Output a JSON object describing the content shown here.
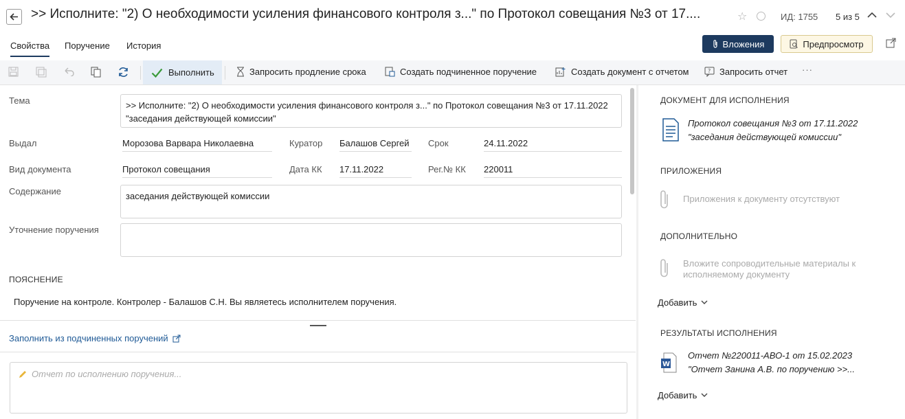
{
  "header": {
    "title": ">> Исполните: \"2) О необходимости усиления финансового контроля з...\" по Протокол совещания №3 от 17....",
    "id_label": "ИД: 1755",
    "pager": "5 из 5"
  },
  "tabs": [
    {
      "label": "Свойства",
      "active": true
    },
    {
      "label": "Поручение",
      "active": false
    },
    {
      "label": "История",
      "active": false
    }
  ],
  "actions": {
    "attachments": "Вложения",
    "preview": "Предпросмотр"
  },
  "toolbar": {
    "execute": "Выполнить",
    "extend": "Запросить продление срока",
    "sub_order": "Создать подчиненное поручение",
    "doc_report": "Создать документ с отчетом",
    "request_report": "Запросить отчет",
    "more": "···"
  },
  "form": {
    "subject_label": "Тема",
    "subject_value": ">> Исполните: \"2) О необходимости усиления финансового контроля з...\" по Протокол совещания №3 от 17.11.2022 \"заседания действующей комиссии\"",
    "issued_label": "Выдал",
    "issued_value": "Морозова Варвара Николаевна",
    "curator_label": "Куратор",
    "curator_value": "Балашов Сергей",
    "deadline_label": "Срок",
    "deadline_value": "24.11.2022",
    "doctype_label": "Вид документа",
    "doctype_value": "Протокол совещания",
    "date_kk_label": "Дата КК",
    "date_kk_value": "17.11.2022",
    "reg_label": "Рег.№ КК",
    "reg_value": "220011",
    "content_label": "Содержание",
    "content_value": "заседания действующей комиссии",
    "clarify_label": "Уточнение поручения",
    "clarify_value": "",
    "note_heading": "ПОЯСНЕНИЕ",
    "note_text": "Поручение на контроле. Контролер - Балашов С.Н. Вы являетесь исполнителем поручения.",
    "fill_link": "Заполнить из подчиненных поручений",
    "report_placeholder": "Отчет по исполнению поручения..."
  },
  "right": {
    "doc_heading": "ДОКУМЕНТ ДЛЯ ИСПОЛНЕНИЯ",
    "doc_line1": "Протокол совещания №3 от 17.11.2022",
    "doc_line2": "\"заседания действующей комиссии\"",
    "att_heading": "ПРИЛОЖЕНИЯ",
    "att_empty": "Приложения к документу отсутствуют",
    "extra_heading": "ДОПОЛНИТЕЛЬНО",
    "extra_line1": "Вложите сопроводительные материалы к",
    "extra_line2": "исполняемому документу",
    "add_label": "Добавить",
    "results_heading": "РЕЗУЛЬТАТЫ ИСПОЛНЕНИЯ",
    "result_line1": "Отчет №220011-АВО-1 от 15.02.2023",
    "result_line2": "\"Отчет Занина А.В. по поручению >>...",
    "add_label2": "Добавить"
  },
  "colors": {
    "primary": "#1d3a5f",
    "link": "#1f5a96",
    "execute_bg": "#e3ecf6",
    "preview_bg": "#fdf7e4"
  }
}
